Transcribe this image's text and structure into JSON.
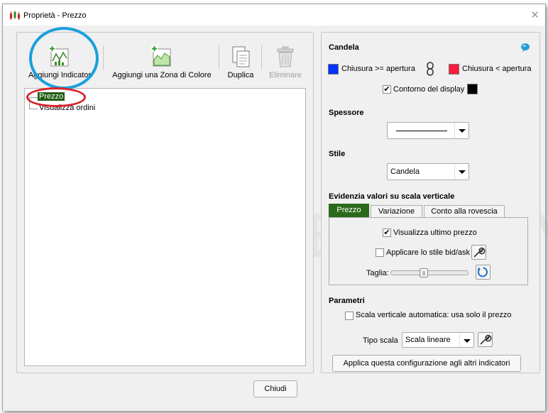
{
  "window": {
    "title": "Proprietà - Prezzo"
  },
  "watermark": "DEMO VERSION",
  "toolbar": {
    "add_indicator": "Aggiungi Indicator",
    "add_color_zone": "Aggiungi una Zona di Colore",
    "duplicate": "Duplica",
    "delete": "Eliminare"
  },
  "tree": {
    "items": [
      {
        "label": "Prezzo",
        "selected": true
      },
      {
        "label": "Visualizza ordini",
        "selected": false
      }
    ]
  },
  "candle": {
    "title": "Candela",
    "close_ge_open": "Chiusura >= apertura",
    "close_lt_open": "Chiusura < apertura",
    "up_color": "#0033ff",
    "down_color": "#ff1a3c",
    "display_outline": "Contorno del display",
    "outline_color": "#000000",
    "outline_checked": true
  },
  "thickness": {
    "title": "Spessore"
  },
  "style": {
    "title": "Stile",
    "value": "Candela"
  },
  "vertical_scale": {
    "title": "Evidenzia valori su scala verticale",
    "tabs": [
      "Prezzo",
      "Variazione",
      "Conto alla rovescia"
    ],
    "active_tab": 0,
    "show_last_price": "Visualizza ultimo prezzo",
    "show_last_price_checked": true,
    "apply_bid_ask": "Applicare lo stile bid/ask",
    "apply_bid_ask_checked": false,
    "size_label": "Taglia:"
  },
  "parameters": {
    "title": "Parametri",
    "auto_scale": "Scala verticale automatica: usa solo il prezzo",
    "auto_scale_checked": false,
    "scale_type_label": "Tipo scala",
    "scale_type_value": "Scala lineare",
    "apply_config": "Applica questa configurazione agli altri indicatori"
  },
  "footer": {
    "close": "Chiudi"
  }
}
